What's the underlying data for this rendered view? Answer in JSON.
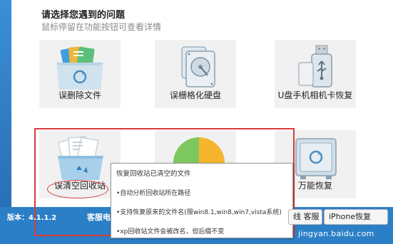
{
  "header": {
    "title": "请选择您遇到的问题",
    "subtitle": "鼠标停留在功能按钮可查看详情"
  },
  "cards": [
    {
      "label": "误删除文件",
      "icon": "files-folder-icon"
    },
    {
      "label": "误栅格化硬盘",
      "icon": "hard-disk-icon"
    },
    {
      "label": "U盘手机相机卡恢复",
      "icon": "usb-drive-icon"
    },
    {
      "label": "误清空回收站",
      "icon": "recycle-bin-icon"
    },
    {
      "label": "",
      "icon": "partition-pie-icon"
    },
    {
      "label": "万能恢复",
      "icon": "safe-box-icon"
    }
  ],
  "tooltip": {
    "heading": "恢复回收站已清空的文件",
    "items": [
      "•自动分析回收站所在路径",
      "•支持恢复原来的文件名(限win8.1,win8,win7,vista系统)",
      "•xp回收站文件会被改名，但后缀不变"
    ]
  },
  "footer": {
    "version": "版本：4.1.1.2",
    "service": "客服电",
    "online_button": "线 客服",
    "iphone_button": "iPhone恢复",
    "watermark": "jingyan.baidu.com"
  },
  "colors": {
    "highlight": "#d93b3b",
    "background_blue": "#2b7fc6"
  }
}
